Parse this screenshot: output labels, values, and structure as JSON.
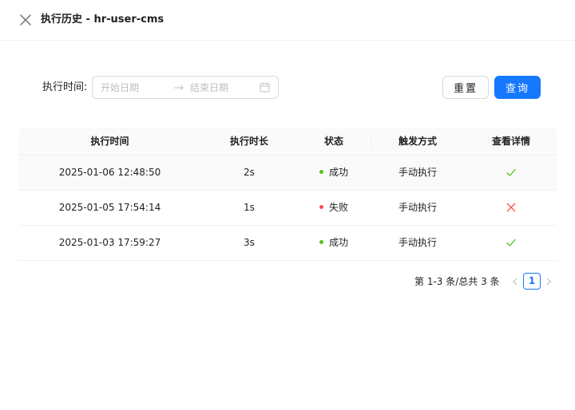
{
  "header": {
    "title": "执行历史 - hr-user-cms",
    "close_icon": "close-icon"
  },
  "filter": {
    "label": "执行时间:",
    "start_placeholder": "开始日期",
    "end_placeholder": "结束日期",
    "separator_icon": "arrow-right-icon",
    "calendar_icon": "calendar-icon",
    "reset_label": "重置",
    "search_label": "查询"
  },
  "table": {
    "columns": [
      "执行时间",
      "执行时长",
      "状态",
      "触发方式",
      "查看详情"
    ],
    "rows": [
      {
        "time": "2025-01-06 12:48:50",
        "duration": "2s",
        "status": "成功",
        "status_color": "#52c41a",
        "trigger": "手动执行",
        "detail_icon": "check-icon",
        "icon_color": "#52c41a"
      },
      {
        "time": "2025-01-05 17:54:14",
        "duration": "1s",
        "status": "失败",
        "status_color": "#ff4d4f",
        "trigger": "手动执行",
        "detail_icon": "close-icon",
        "icon_color": "#ff4d4f"
      },
      {
        "time": "2025-01-03 17:59:27",
        "duration": "3s",
        "status": "成功",
        "status_color": "#52c41a",
        "trigger": "手动执行",
        "detail_icon": "check-icon",
        "icon_color": "#52c41a"
      }
    ]
  },
  "pagination": {
    "total_text": "第 1-3 条/总共 3 条",
    "current_page": "1",
    "prev_icon": "chevron-left-icon",
    "next_icon": "chevron-right-icon"
  },
  "colors": {
    "primary": "#1677ff",
    "success": "#52c41a",
    "error": "#ff4d4f"
  }
}
